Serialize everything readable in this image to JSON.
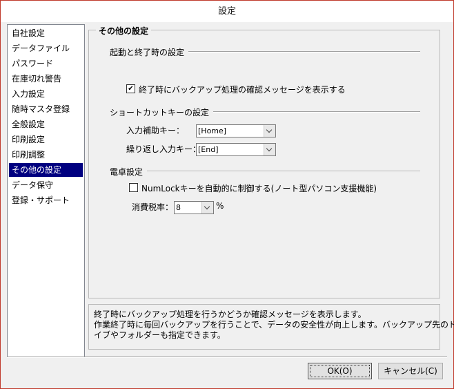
{
  "window": {
    "title": "設定"
  },
  "nav": {
    "items": [
      {
        "label": "自社設定",
        "selected": false
      },
      {
        "label": "データファイル",
        "selected": false
      },
      {
        "label": "パスワード",
        "selected": false
      },
      {
        "label": "在庫切れ警告",
        "selected": false
      },
      {
        "label": "入力設定",
        "selected": false
      },
      {
        "label": "随時マスタ登録",
        "selected": false
      },
      {
        "label": "全般設定",
        "selected": false
      },
      {
        "label": "印刷設定",
        "selected": false
      },
      {
        "label": "印刷調整",
        "selected": false
      },
      {
        "label": "その他の設定",
        "selected": true
      },
      {
        "label": "データ保守",
        "selected": false
      },
      {
        "label": "登録・サポート",
        "selected": false
      }
    ]
  },
  "panel": {
    "title": "その他の設定",
    "startup": {
      "heading": "起動と終了時の設定",
      "confirm_backup": {
        "label": "終了時にバックアップ処理の確認メッセージを表示する",
        "checked": true
      }
    },
    "shortcut": {
      "heading": "ショートカットキーの設定",
      "assist_key_label": "入力補助キー：",
      "assist_key_value": "[Home]",
      "repeat_key_label": "繰り返し入力キー：",
      "repeat_key_value": "[End]"
    },
    "calculator": {
      "heading": "電卓設定",
      "numlock": {
        "label": "NumLockキーを自動的に制御する(ノート型パソコン支援機能)",
        "checked": false
      },
      "tax_label": "消費税率：",
      "tax_value": "8",
      "tax_unit": "%"
    }
  },
  "description": {
    "line1": "終了時にバックアップ処理を行うかどうか確認メッセージを表示します。",
    "line2": "作業終了時に毎回バックアップを行うことで、データの安全性が向上します。バックアップ先のドラ",
    "line3": "イブやフォルダーも指定できます。"
  },
  "buttons": {
    "ok": "OK(O)",
    "cancel": "キャンセル(C)"
  },
  "colors": {
    "selection": "#000080",
    "background": "#f0f0f0",
    "window_border": "#c0392b"
  }
}
